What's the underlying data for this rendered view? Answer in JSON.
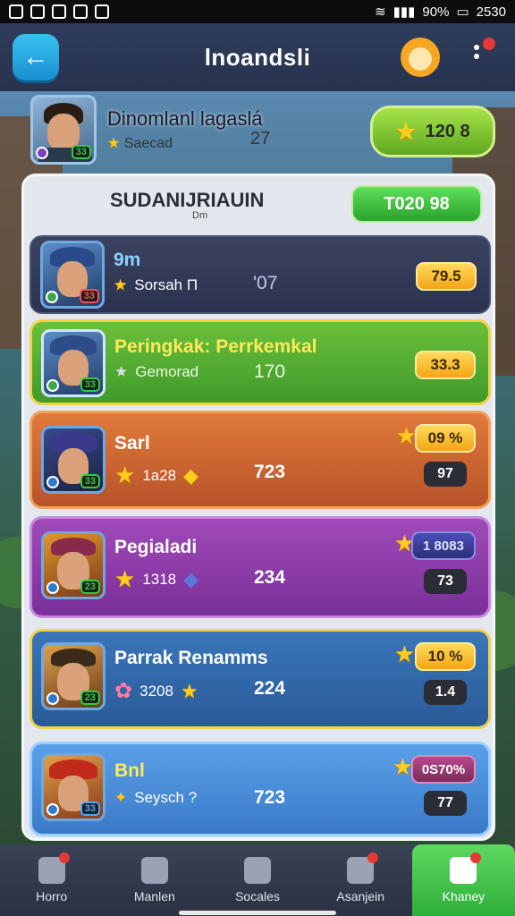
{
  "status_bar": {
    "battery": "90%",
    "time": "2530"
  },
  "header": {
    "title": "lnoandsli"
  },
  "top_player": {
    "name": "Dinomlanl lagaslá",
    "sub": "Saecad",
    "number": "27",
    "score": "120 8"
  },
  "panel": {
    "title": "SUDANIJRIAUIN",
    "subtitle": "Dm",
    "score": "T020 98"
  },
  "rows": [
    {
      "name": "9m",
      "sub": "Sorsah Π",
      "number": "'07",
      "pill": "79.5",
      "badge": "33",
      "theme": "dark"
    },
    {
      "name": "Peringkak: Perrkemkal",
      "sub": "Gemorad",
      "number": "170",
      "pill": "33.3",
      "badge": "33",
      "theme": "green"
    },
    {
      "name": "Sarl",
      "sub": "1a28",
      "number": "723",
      "pill": "09 %",
      "pill2": "97",
      "badge": "33",
      "theme": "orange"
    },
    {
      "name": "Pegialadi",
      "sub": "1318",
      "number": "234",
      "pill": "1 8083",
      "pill2": "73",
      "badge": "23",
      "theme": "purple"
    },
    {
      "name": "Parrak Renamms",
      "sub": "3208",
      "number": "224",
      "pill": "10 %",
      "pill2": "1.4",
      "badge": "23",
      "theme": "blue"
    },
    {
      "name": "Bnl",
      "sub": "Seysch ?",
      "number": "723",
      "pill": "0S70%",
      "pill2": "77",
      "badge": "33",
      "theme": "lightblue"
    }
  ],
  "nav": [
    {
      "label": "Horro",
      "icon": "home-icon"
    },
    {
      "label": "Manlen",
      "icon": "mission-icon"
    },
    {
      "label": "Socales",
      "icon": "social-icon"
    },
    {
      "label": "Asanjein",
      "icon": "achievement-icon"
    },
    {
      "label": "Khaney",
      "icon": "leaderboard-icon",
      "active": true
    }
  ]
}
